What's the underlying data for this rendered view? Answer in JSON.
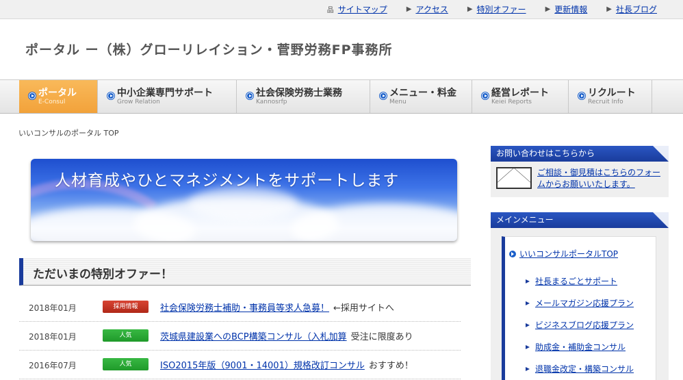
{
  "topbar": {
    "links": [
      {
        "label": "サイトマップ",
        "icon": "sitemap-icon"
      },
      {
        "label": "アクセス",
        "icon": "arrow-icon"
      },
      {
        "label": "特別オファー",
        "icon": "arrow-icon"
      },
      {
        "label": "更新情報",
        "icon": "arrow-icon"
      },
      {
        "label": "社長ブログ",
        "icon": "arrow-icon"
      }
    ]
  },
  "header": {
    "title": "ポータル ー（株）グローリレイション・菅野労務FP事務所"
  },
  "gnav": {
    "items": [
      {
        "label": "ポータル",
        "sub": "E-Consul"
      },
      {
        "label": "中小企業専門サポート",
        "sub": "Grow Relation"
      },
      {
        "label": "社会保険労務士業務",
        "sub": "Kannosrfp"
      },
      {
        "label": "メニュー・料金",
        "sub": "Menu"
      },
      {
        "label": "経営レポート",
        "sub": "Keiei Reports"
      },
      {
        "label": "リクルート",
        "sub": "Recruit Info"
      }
    ]
  },
  "breadcrumb": "いいコンサルのポータル TOP",
  "banner": {
    "text": "人材育成やひとマネジメントをサポートします"
  },
  "offers": {
    "heading": "ただいまの特別オファー！",
    "rows": [
      {
        "date": "2018年01月",
        "badge": "採用情報",
        "badge_color": "#c0392b",
        "link": "社会保険労務士補助・事務員等求人急募！",
        "note": "←採用サイトへ"
      },
      {
        "date": "2018年01月",
        "badge": "人気",
        "badge_color": "#2aa836",
        "link": "茨城県建設業へのBCP構築コンサル（入札加算",
        "note": "受注に限度あり"
      },
      {
        "date": "2016年07月",
        "badge": "人気",
        "badge_color": "#2aa836",
        "link": "ISO2015年版（9001・14001）規格改訂コンサル",
        "note": "おすすめ！"
      }
    ]
  },
  "sidebar": {
    "contact": {
      "heading": "お問い合わせはこちらから",
      "link": "ご相談・御見積はこちらのフォームからお願いいたします。"
    },
    "menu": {
      "heading": "メインメニュー",
      "top": "いいコンサルポータルTOP",
      "items": [
        "社長まるごとサポート",
        "メールマガジン応援プラン",
        "ビジネスブログ応援プラン",
        "助成金・補助金コンサル",
        "退職金改定・構築コンサル"
      ]
    }
  },
  "colors": {
    "accent": "#1a3c9c",
    "nav_active": "#f2a23a",
    "link": "#0033aa"
  }
}
